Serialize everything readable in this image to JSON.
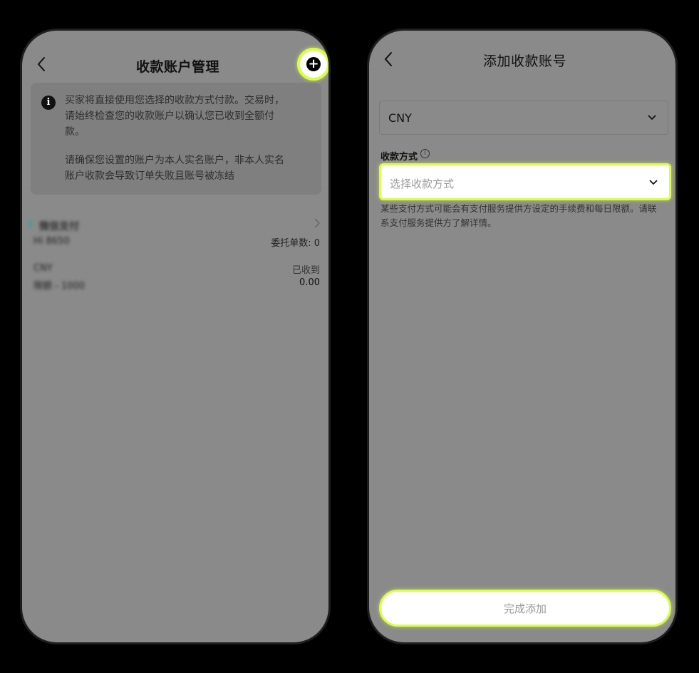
{
  "left_screen": {
    "title": "收款账户管理",
    "add_button_glyph": "+",
    "notice": {
      "icon": "i",
      "line1": "买家将直接使用您选择的收款方式付款。交易时，",
      "line2": "请始终检查您的收款账户以确认您已收到全额付",
      "line3": "款。",
      "line4": "请确保您设置的账户为本人实名账户，非本人实名",
      "line5": "账户收款会导致订单失败且账号被冻结"
    },
    "account": {
      "name": "微信支付",
      "sub": "Hi 8650",
      "count_label": "委托单数: 0",
      "currency": "CNY",
      "range": "限额 - 1000",
      "received_label": "已收到",
      "received_value": "0.00"
    }
  },
  "right_screen": {
    "title": "添加收款账号",
    "currency_value": "CNY",
    "method_label": "收款方式",
    "method_placeholder": "选择收款方式",
    "hint_line1": "某些支付方式可能会有支付服务提供方设定的手续费和每日限额。请联",
    "hint_line2": "系支付服务提供方了解详情。",
    "submit_label": "完成添加"
  },
  "colors": {
    "highlight": "#d8ff45",
    "overlay_gray": "#8a8a8a"
  }
}
